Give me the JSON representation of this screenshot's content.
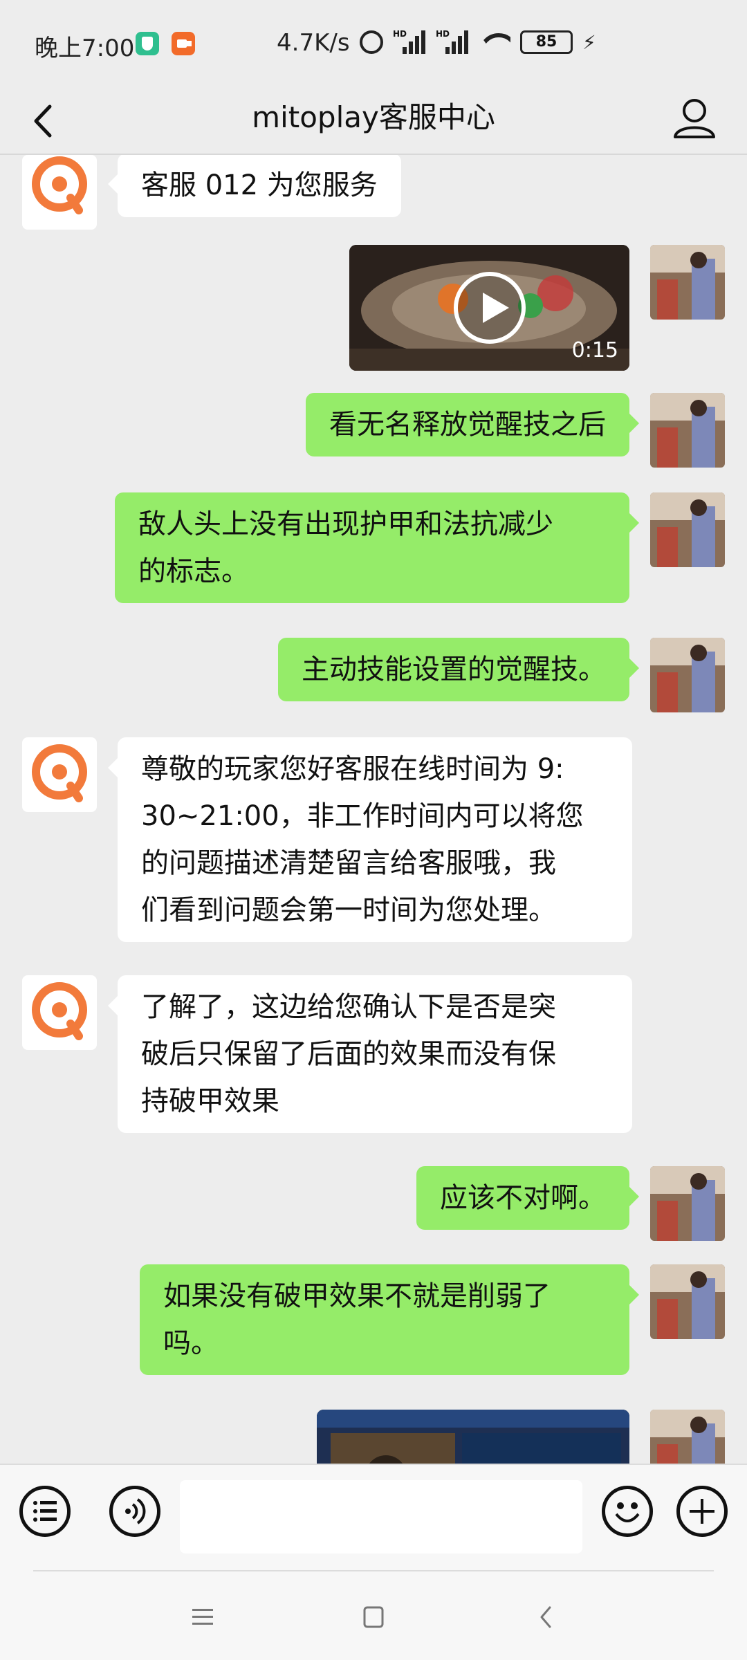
{
  "status_bar": {
    "time": "晚上7:00",
    "net_speed": "4.7K/s",
    "battery": "85",
    "icons": [
      "shield-app-icon",
      "screen-record-icon",
      "alarm-icon",
      "hd-signal-icon",
      "hd-signal-icon",
      "wifi-icon",
      "battery-icon",
      "charging-icon"
    ]
  },
  "header": {
    "title": "mitoplay客服中心",
    "back_icon": "chevron-left-icon",
    "profile_icon": "person-icon"
  },
  "messages": [
    {
      "side": "in",
      "type": "text",
      "text": "客服 012 为您服务"
    },
    {
      "side": "out",
      "type": "video",
      "duration": "0:15"
    },
    {
      "side": "out",
      "type": "text",
      "text": "看无名释放觉醒技之后"
    },
    {
      "side": "out",
      "type": "text",
      "lines": [
        "敌人头上没有出现护甲和法抗减少",
        "的标志。"
      ]
    },
    {
      "side": "out",
      "type": "text",
      "text": "主动技能设置的觉醒技。"
    },
    {
      "side": "in",
      "type": "text",
      "lines": [
        "尊敬的玩家您好客服在线时间为 9:",
        "30~21:00，非工作时间内可以将您",
        "的问题描述清楚留言给客服哦，我",
        "们看到问题会第一时间为您处理。"
      ]
    },
    {
      "side": "in",
      "type": "text",
      "lines": [
        "了解了，这边给您确认下是否是突",
        "破后只保留了后面的效果而没有保",
        "持破甲效果"
      ]
    },
    {
      "side": "out",
      "type": "text",
      "text": "应该不对啊。"
    },
    {
      "side": "out",
      "type": "text",
      "lines": [
        "如果没有破甲效果不就是削弱了",
        "吗。"
      ]
    },
    {
      "side": "out",
      "type": "image"
    }
  ],
  "input_bar": {
    "value": "",
    "icons": [
      "list-icon",
      "voice-icon",
      "emoji-icon",
      "plus-icon"
    ]
  },
  "nav_bar": {
    "icons": [
      "menu-icon",
      "home-icon",
      "back-icon"
    ]
  }
}
